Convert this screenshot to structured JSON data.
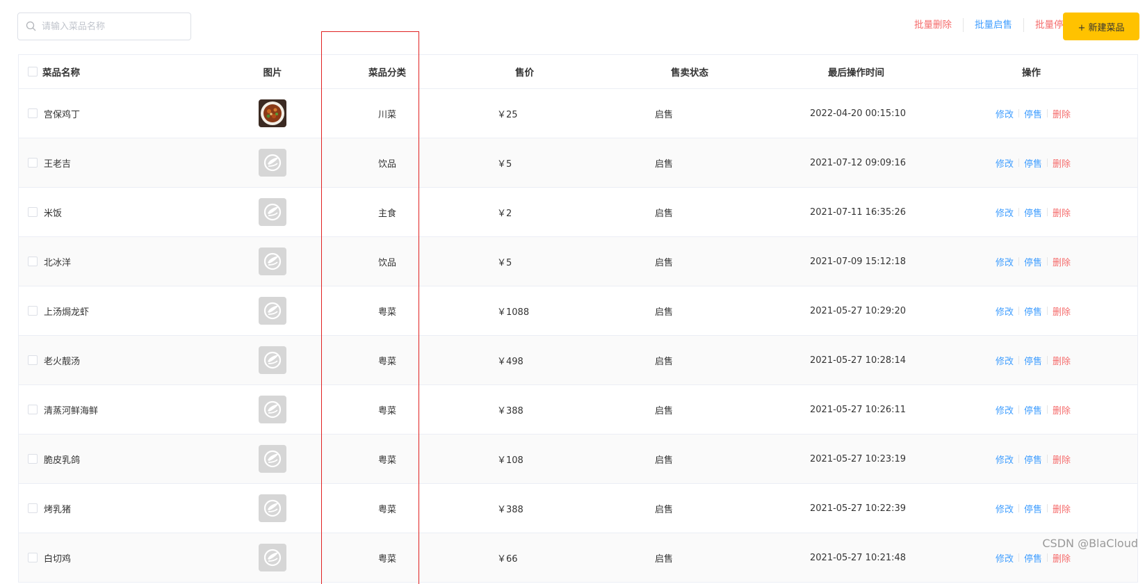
{
  "search": {
    "placeholder": "请输入菜品名称",
    "value": ""
  },
  "toolbar": {
    "batch_delete": "批量删除",
    "batch_enable": "批量启售",
    "batch_disable": "批量停售",
    "new_dish": "+ 新建菜品"
  },
  "colors": {
    "accent": "#ffc200",
    "link_blue": "#409eff",
    "danger_red": "#f56c6c",
    "highlight": "#e02020"
  },
  "table": {
    "headers": {
      "name": "菜品名称",
      "image": "图片",
      "category": "菜品分类",
      "price": "售价",
      "status": "售卖状态",
      "updated": "最后操作时间",
      "actions": "操作"
    },
    "rows": [
      {
        "name": "宫保鸡丁",
        "image": "food-photo",
        "category": "川菜",
        "price": "￥25",
        "status": "启售",
        "updated": "2022-04-20 00:15:10"
      },
      {
        "name": "王老吉",
        "image": "placeholder-logo",
        "category": "饮品",
        "price": "￥5",
        "status": "启售",
        "updated": "2021-07-12 09:09:16"
      },
      {
        "name": "米饭",
        "image": "placeholder-logo",
        "category": "主食",
        "price": "￥2",
        "status": "启售",
        "updated": "2021-07-11 16:35:26"
      },
      {
        "name": "北冰洋",
        "image": "placeholder-logo",
        "category": "饮品",
        "price": "￥5",
        "status": "启售",
        "updated": "2021-07-09 15:12:18"
      },
      {
        "name": "上汤焗龙虾",
        "image": "placeholder-logo",
        "category": "粤菜",
        "price": "￥1088",
        "status": "启售",
        "updated": "2021-05-27 10:29:20"
      },
      {
        "name": "老火靓汤",
        "image": "placeholder-logo",
        "category": "粤菜",
        "price": "￥498",
        "status": "启售",
        "updated": "2021-05-27 10:28:14"
      },
      {
        "name": "清蒸河鲜海鲜",
        "image": "placeholder-logo",
        "category": "粤菜",
        "price": "￥388",
        "status": "启售",
        "updated": "2021-05-27 10:26:11"
      },
      {
        "name": "脆皮乳鸽",
        "image": "placeholder-logo",
        "category": "粤菜",
        "price": "￥108",
        "status": "启售",
        "updated": "2021-05-27 10:23:19"
      },
      {
        "name": "烤乳猪",
        "image": "placeholder-logo",
        "category": "粤菜",
        "price": "￥388",
        "status": "启售",
        "updated": "2021-05-27 10:22:39"
      },
      {
        "name": "白切鸡",
        "image": "placeholder-logo",
        "category": "粤菜",
        "price": "￥66",
        "status": "启售",
        "updated": "2021-05-27 10:21:48"
      }
    ],
    "row_actions": {
      "edit": "修改",
      "disable": "停售",
      "delete": "删除"
    }
  },
  "watermark": "CSDN @BlaCloud"
}
